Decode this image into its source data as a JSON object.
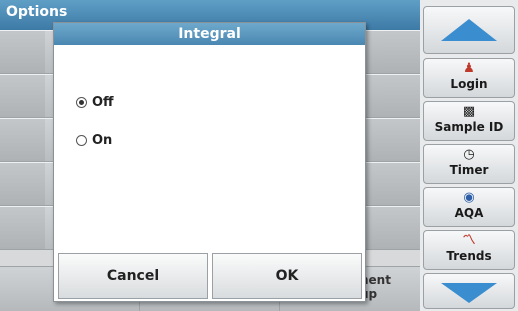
{
  "window": {
    "title": "Options"
  },
  "background": {
    "bottom_partial_label": "nent\nup"
  },
  "dialog": {
    "title": "Integral",
    "options": [
      {
        "label": "Off",
        "checked": true
      },
      {
        "label": "On",
        "checked": false
      }
    ],
    "cancel_label": "Cancel",
    "ok_label": "OK"
  },
  "sidebar": {
    "up_icon": "up-arrow-icon",
    "down_icon": "down-arrow-icon",
    "items": [
      {
        "label": "Login",
        "icon": "person-icon",
        "glyph": "🚹"
      },
      {
        "label": "Sample ID",
        "icon": "sample-icon",
        "glyph": "⌂"
      },
      {
        "label": "Timer",
        "icon": "timer-icon",
        "glyph": "⏲"
      },
      {
        "label": "AQA",
        "icon": "aqa-icon",
        "glyph": "◉"
      },
      {
        "label": "Trends",
        "icon": "trends-icon",
        "glyph": "〽"
      }
    ]
  },
  "colors": {
    "title_bar": "#3d7aa6",
    "dialog_title": "#4a87b1",
    "arrow": "#3a8dcf",
    "login_icon": "#c0392b"
  }
}
